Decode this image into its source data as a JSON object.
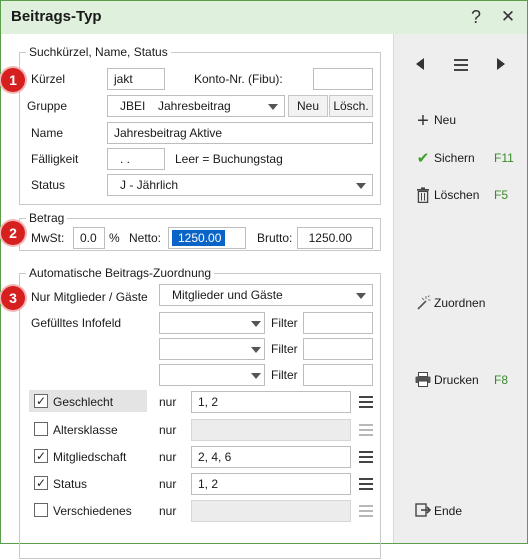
{
  "window": {
    "title": "Beitrags-Typ",
    "help_symbol": "?",
    "close_symbol": "✕"
  },
  "badges": [
    "1",
    "2",
    "3"
  ],
  "section1": {
    "legend": "Suchkürzel, Name, Status",
    "kurzel_label": "Kürzel",
    "kurzel_value": "jakt",
    "konto_label": "Konto-Nr. (Fibu):",
    "konto_value": "",
    "gruppe_label": "Gruppe",
    "gruppe_code": "JBEI",
    "gruppe_name": "Jahresbeitrag",
    "neu_button": "Neu",
    "losch_button": "Lösch.",
    "name_label": "Name",
    "name_value": "Jahresbeitrag Aktive",
    "faelligkeit_label": "Fälligkeit",
    "faelligkeit_value": ". .",
    "faelligkeit_hint": "Leer = Buchungstag",
    "status_label": "Status",
    "status_value": "J - Jährlich"
  },
  "section2": {
    "legend": "Betrag",
    "mwst_label": "MwSt:",
    "mwst_value": "0.0",
    "percent": "%",
    "netto_label": "Netto:",
    "netto_value": "1250.00",
    "brutto_label": "Brutto:",
    "brutto_value": "1250.00"
  },
  "section3": {
    "legend": "Automatische Beitrags-Zuordnung",
    "nur_mitglieder_label": "Nur Mitglieder / Gäste",
    "nur_mitglieder_value": "Mitglieder und Gäste",
    "infofeld_label": "Gefülltes Infofeld",
    "filter_label": "Filter",
    "infofeld_rows": [
      {
        "select": "",
        "filter": ""
      },
      {
        "select": "",
        "filter": ""
      },
      {
        "select": "",
        "filter": ""
      }
    ],
    "nur_label": "nur",
    "criteria": [
      {
        "label": "Geschlecht",
        "checked": true,
        "value": "1, 2",
        "enabled": true
      },
      {
        "label": "Altersklasse",
        "checked": false,
        "value": "",
        "enabled": false
      },
      {
        "label": "Mitgliedschaft",
        "checked": true,
        "value": "2, 4, 6",
        "enabled": true
      },
      {
        "label": "Status",
        "checked": true,
        "value": "1, 2",
        "enabled": true
      },
      {
        "label": "Verschiedenes",
        "checked": false,
        "value": "",
        "enabled": false
      }
    ]
  },
  "sidebar": {
    "neu": "Neu",
    "sichern": "Sichern",
    "sichern_key": "F11",
    "loschen": "Löschen",
    "loschen_key": "F5",
    "zuordnen": "Zuordnen",
    "drucken": "Drucken",
    "drucken_key": "F8",
    "ende": "Ende"
  },
  "colors": {
    "titlebar_bg": "#dff0dc",
    "window_border": "#5a9e4a",
    "badge_red": "#d62020",
    "selection_blue": "#0a64c8",
    "shortcut_green": "#3a8a2a",
    "check_green": "#3aa02a"
  }
}
